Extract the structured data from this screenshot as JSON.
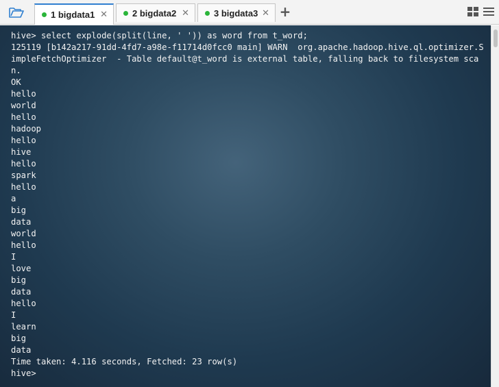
{
  "tabs": [
    {
      "label": "1 bigdata1",
      "status_color": "#2bb53a",
      "active": true
    },
    {
      "label": "2 bigdata2",
      "status_color": "#2bb53a",
      "active": false
    },
    {
      "label": "3 bigdata3",
      "status_color": "#2bb53a",
      "active": false
    }
  ],
  "toolbar": {
    "folder_icon": "open-folder-icon",
    "add_tab_icon": "plus-icon",
    "grid_icon": "grid-view-icon",
    "menu_icon": "hamburger-menu-icon",
    "close_glyph": "✕",
    "plus_glyph": "+"
  },
  "terminal": {
    "lines": [
      "hive> select explode(split(line, ' ')) as word from t_word;",
      "125119 [b142a217-91dd-4fd7-a98e-f11714d0fcc0 main] WARN  org.apache.hadoop.hive.ql.optimizer.SimpleFetchOptimizer  - Table default@t_word is external table, falling back to filesystem scan.",
      "OK",
      "hello",
      "world",
      "hello",
      "hadoop",
      "hello",
      "hive",
      "hello",
      "spark",
      "hello",
      "a",
      "big",
      "data",
      "world",
      "hello",
      "I",
      "love",
      "big",
      "data",
      "hello",
      "I",
      "learn",
      "big",
      "data",
      "Time taken: 4.116 seconds, Fetched: 23 row(s)",
      "hive>"
    ]
  },
  "colors": {
    "accent": "#2f7fd0",
    "terminal_text": "#f2f2f2",
    "terminal_bg": "#2a4458",
    "status_green": "#2bb53a"
  }
}
